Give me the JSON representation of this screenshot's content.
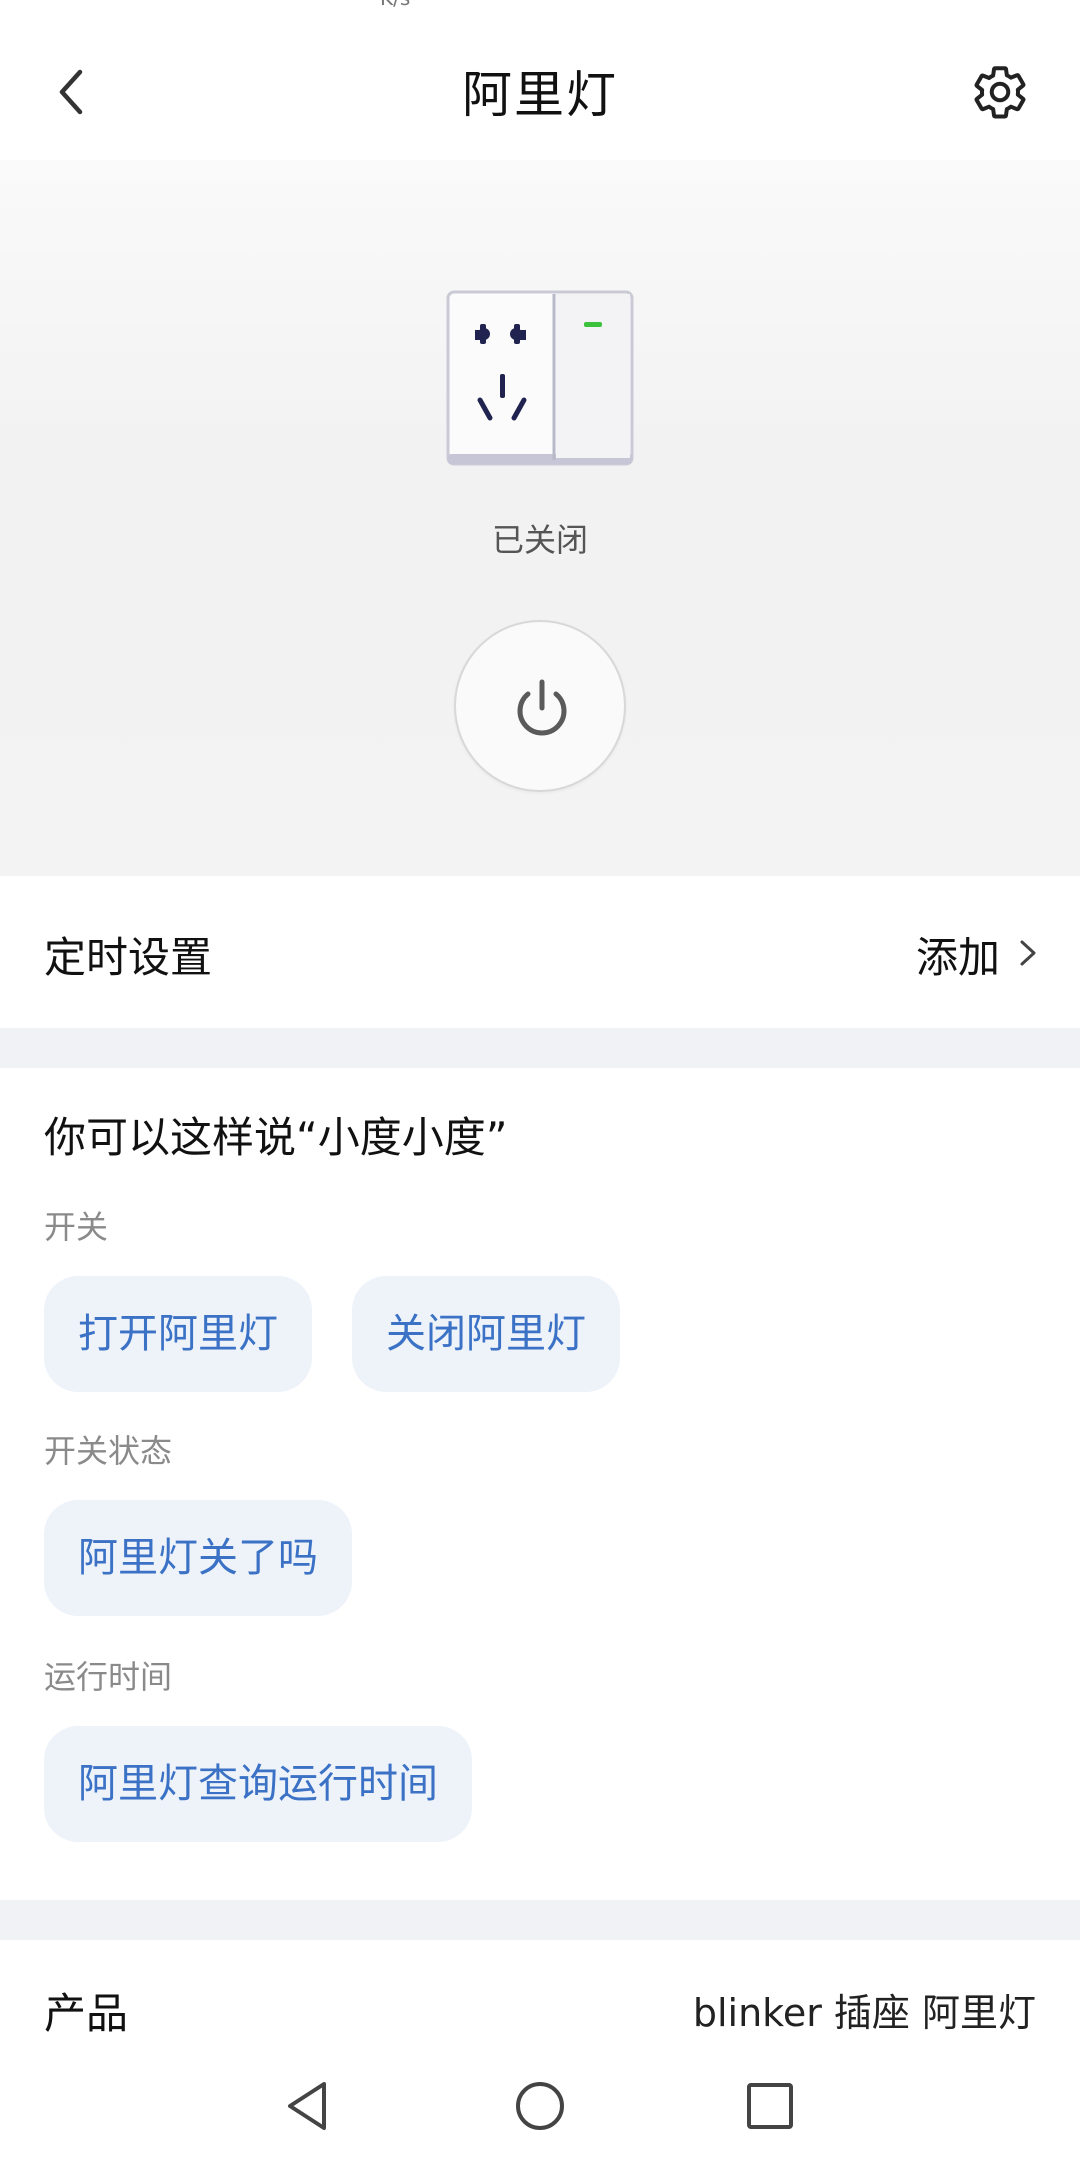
{
  "status": {
    "fragment": "K/s"
  },
  "header": {
    "title": "阿里灯"
  },
  "device": {
    "state_label": "已关闭",
    "indicator_color": "#3cc13c"
  },
  "timer": {
    "label": "定时设置",
    "action": "添加"
  },
  "voice": {
    "heading": "你可以这样说“小度小度”",
    "groups": [
      {
        "label": "开关",
        "commands": [
          "打开阿里灯",
          "关闭阿里灯"
        ]
      },
      {
        "label": "开关状态",
        "commands": [
          "阿里灯关了吗"
        ]
      },
      {
        "label": "运行时间",
        "commands": [
          "阿里灯查询运行时间"
        ]
      }
    ]
  },
  "product": {
    "label": "产品",
    "value": "blinker 插座 阿里灯"
  },
  "colors": {
    "accent": "#3b72c6",
    "chip_bg": "#eef3fa",
    "divider": "#f1f2f5"
  }
}
